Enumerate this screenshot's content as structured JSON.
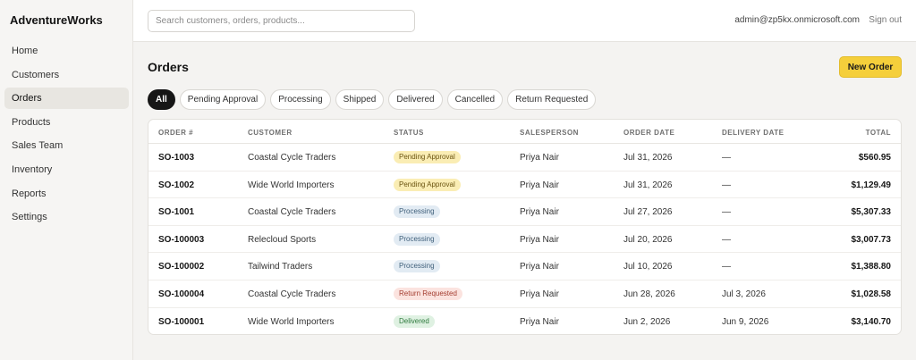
{
  "app": {
    "brand": "AdventureWorks"
  },
  "sidebar": {
    "items": [
      {
        "label": "Home",
        "active": false
      },
      {
        "label": "Customers",
        "active": false
      },
      {
        "label": "Orders",
        "active": true
      },
      {
        "label": "Products",
        "active": false
      },
      {
        "label": "Sales Team",
        "active": false
      },
      {
        "label": "Inventory",
        "active": false
      },
      {
        "label": "Reports",
        "active": false
      },
      {
        "label": "Settings",
        "active": false
      }
    ]
  },
  "header": {
    "search_placeholder": "Search customers, orders, products...",
    "user_email": "admin@zp5kx.onmicrosoft.com",
    "signout_label": "Sign out"
  },
  "main": {
    "title": "Orders",
    "new_order_label": "New Order",
    "filters": [
      {
        "label": "All",
        "active": true
      },
      {
        "label": "Pending Approval",
        "active": false
      },
      {
        "label": "Processing",
        "active": false
      },
      {
        "label": "Shipped",
        "active": false
      },
      {
        "label": "Delivered",
        "active": false
      },
      {
        "label": "Cancelled",
        "active": false
      },
      {
        "label": "Return Requested",
        "active": false
      }
    ],
    "table": {
      "columns": [
        "Order #",
        "Customer",
        "Status",
        "Salesperson",
        "Order Date",
        "Delivery Date",
        "Total"
      ],
      "rows": [
        {
          "order": "SO-1003",
          "customer": "Coastal Cycle Traders",
          "status": "Pending Approval",
          "status_kind": "pending",
          "salesperson": "Priya Nair",
          "order_date": "Jul 31, 2026",
          "delivery_date": "—",
          "total": "$560.95"
        },
        {
          "order": "SO-1002",
          "customer": "Wide World Importers",
          "status": "Pending Approval",
          "status_kind": "pending",
          "salesperson": "Priya Nair",
          "order_date": "Jul 31, 2026",
          "delivery_date": "—",
          "total": "$1,129.49"
        },
        {
          "order": "SO-1001",
          "customer": "Coastal Cycle Traders",
          "status": "Processing",
          "status_kind": "processing",
          "salesperson": "Priya Nair",
          "order_date": "Jul 27, 2026",
          "delivery_date": "—",
          "total": "$5,307.33"
        },
        {
          "order": "SO-100003",
          "customer": "Relecloud Sports",
          "status": "Processing",
          "status_kind": "processing",
          "salesperson": "Priya Nair",
          "order_date": "Jul 20, 2026",
          "delivery_date": "—",
          "total": "$3,007.73"
        },
        {
          "order": "SO-100002",
          "customer": "Tailwind Traders",
          "status": "Processing",
          "status_kind": "processing",
          "salesperson": "Priya Nair",
          "order_date": "Jul 10, 2026",
          "delivery_date": "—",
          "total": "$1,388.80"
        },
        {
          "order": "SO-100004",
          "customer": "Coastal Cycle Traders",
          "status": "Return Requested",
          "status_kind": "returned",
          "salesperson": "Priya Nair",
          "order_date": "Jun 28, 2026",
          "delivery_date": "Jul 3, 2026",
          "total": "$1,028.58"
        },
        {
          "order": "SO-100001",
          "customer": "Wide World Importers",
          "status": "Delivered",
          "status_kind": "delivered",
          "salesperson": "Priya Nair",
          "order_date": "Jun 2, 2026",
          "delivery_date": "Jun 9, 2026",
          "total": "$3,140.70"
        }
      ]
    }
  },
  "colors": {
    "accent": "#f5cf3b",
    "chip_active": "#161616",
    "pending": "#faedb4",
    "processing": "#e2ebf3",
    "returned": "#fbe3df",
    "delivered": "#dff1e2"
  }
}
